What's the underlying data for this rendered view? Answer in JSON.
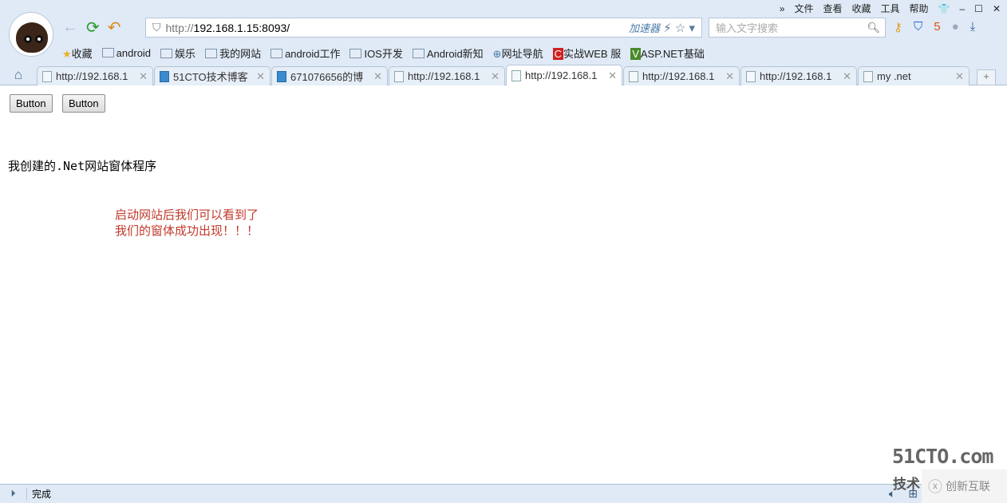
{
  "menu": [
    "文件",
    "查看",
    "收藏",
    "工具",
    "帮助"
  ],
  "address": {
    "proto": "http://",
    "host": "192.168.1.15:8093/",
    "accelerator": "加速器"
  },
  "search": {
    "placeholder": "输入文字搜索"
  },
  "bookmarks": [
    {
      "label": "收藏",
      "type": "star"
    },
    {
      "label": "android",
      "type": "folder"
    },
    {
      "label": "娱乐",
      "type": "folder"
    },
    {
      "label": "我的网站",
      "type": "folder"
    },
    {
      "label": "android工作",
      "type": "folder"
    },
    {
      "label": "IOS开发",
      "type": "folder"
    },
    {
      "label": "Android新知",
      "type": "folder"
    },
    {
      "label": "网址导航",
      "type": "globe"
    },
    {
      "label": "实战WEB 服",
      "type": "link"
    },
    {
      "label": "ASP.NET基础",
      "type": "link"
    }
  ],
  "tabs": [
    {
      "label": "http://192.168.1",
      "active": false
    },
    {
      "label": "51CTO技术博客",
      "active": false
    },
    {
      "label": "671076656的博",
      "active": false
    },
    {
      "label": "http://192.168.1",
      "active": false
    },
    {
      "label": "http://192.168.1",
      "active": true
    },
    {
      "label": "http://192.168.1",
      "active": false
    },
    {
      "label": "http://192.168.1",
      "active": false
    },
    {
      "label": "my .net",
      "active": false
    }
  ],
  "page": {
    "button1": "Button",
    "button2": "Button",
    "heading": "我创建的.Net网站窗体程序",
    "note_line1": "启动网站后我们可以看到了",
    "note_line2": "我们的窗体成功出现！！！"
  },
  "status": {
    "text": "完成"
  },
  "watermark": {
    "site": "51CTO.com",
    "sub": "技术",
    "brand": "创新互联"
  },
  "colors": {
    "chrome": "#dfeaf6",
    "note": "#c0392b"
  }
}
